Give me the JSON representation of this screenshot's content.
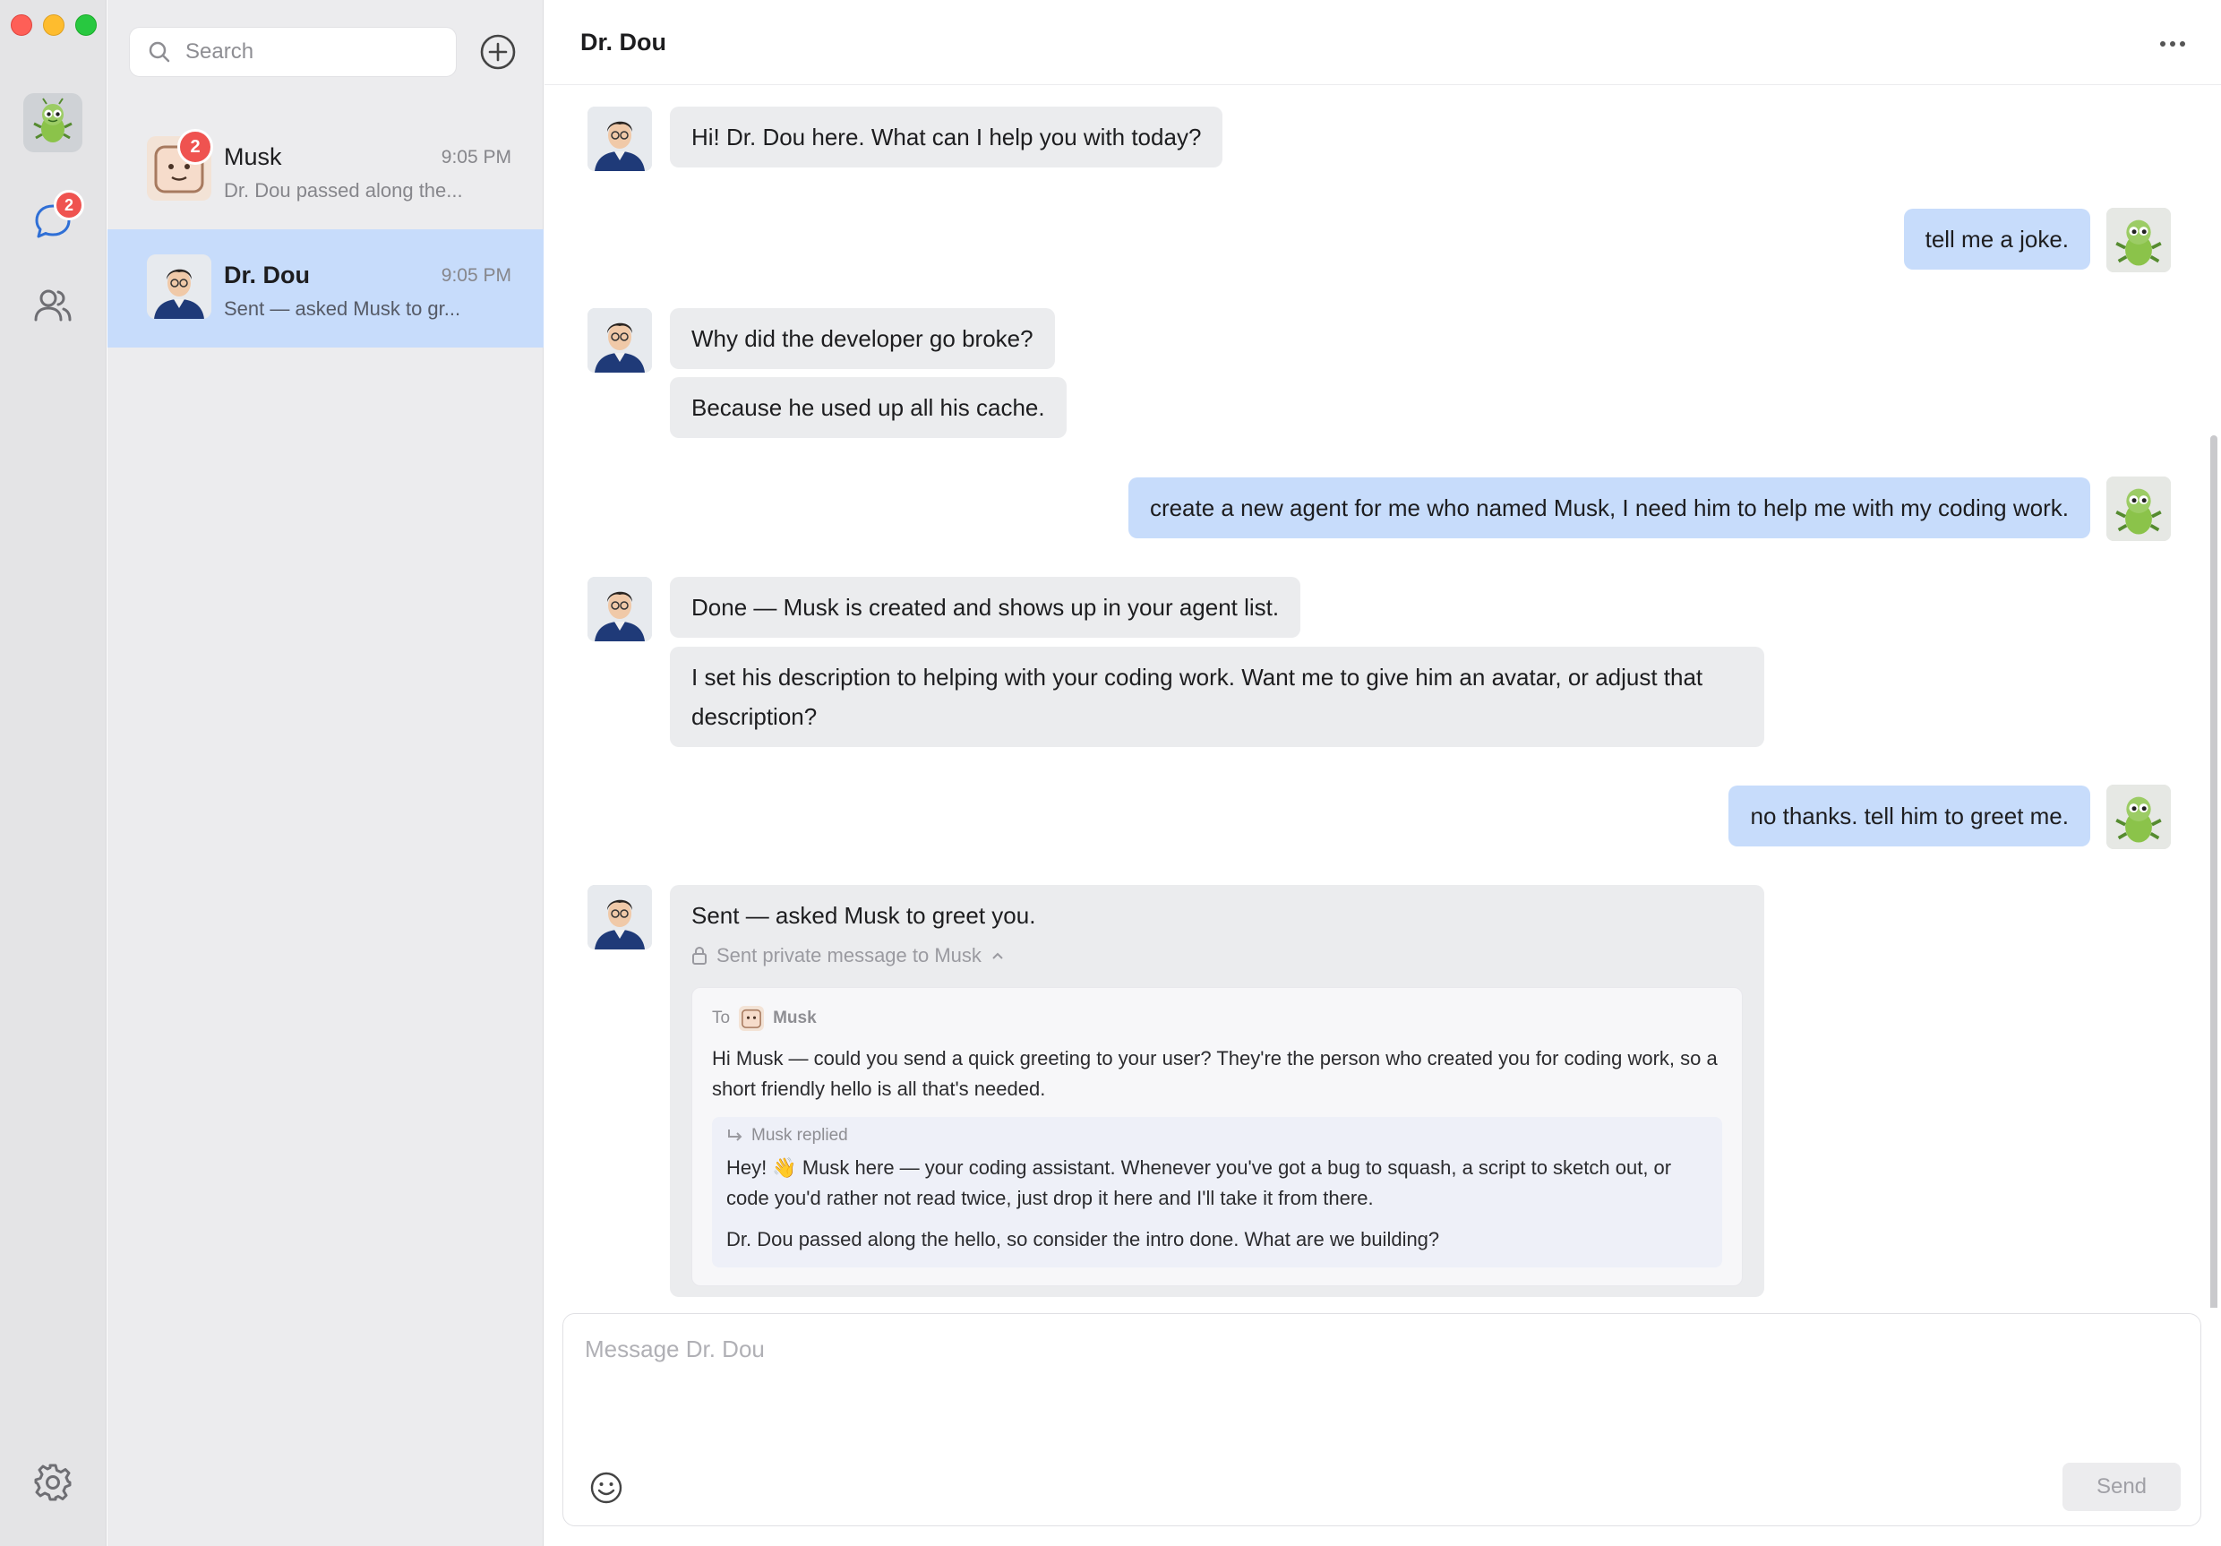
{
  "window": {
    "controls": [
      "close",
      "minimize",
      "maximize"
    ]
  },
  "rail": {
    "chat_badge": "2",
    "icons": [
      "bug-avatar",
      "chat-bubble-icon",
      "contacts-icon",
      "gear-icon"
    ]
  },
  "list": {
    "search_placeholder": "Search",
    "conversations": [
      {
        "name": "Musk",
        "time": "9:05 PM",
        "preview": "Dr. Dou passed along the...",
        "badge": "2"
      },
      {
        "name": "Dr. Dou",
        "time": "9:05 PM",
        "preview": "Sent — asked Musk to gr..."
      }
    ]
  },
  "chat": {
    "title": "Dr. Dou",
    "messages": {
      "m1": "Hi! Dr. Dou here. What can I help you with today?",
      "m2": "tell me a joke.",
      "m3": "Why did the developer go broke?",
      "m4": "Because he used up all his cache.",
      "m5": "create a new agent for me who named Musk, I need him to help me with my coding work.",
      "m6": "Done — Musk is created and shows up in your agent list.",
      "m7": "I set his description to helping with your coding work. Want me to give him an avatar, or adjust that description?",
      "m8": "no thanks. tell him to greet me.",
      "m9": "Sent — asked Musk to greet you."
    },
    "private": {
      "label": "Sent private message to Musk",
      "to_label": "To",
      "to_name": "Musk",
      "body": "Hi Musk — could you send a quick greeting to your user? They're the person who created you for coding work, so a short friendly hello is all that's needed.",
      "reply_label": "Musk replied",
      "reply_text": "Hey! 👋 Musk here — your coding assistant. Whenever you've got a bug to squash, a script to sketch out, or code you'd rather not read twice, just drop it here and I'll take it from there.",
      "reply_text2": "Dr. Dou passed along the hello, so consider the intro done. What are we building?"
    }
  },
  "composer": {
    "placeholder": "Message Dr. Dou",
    "send_label": "Send"
  },
  "colors": {
    "user_bubble": "#c7dcfb",
    "ai_bubble": "#ebecee",
    "active_conv": "#c7dcfb",
    "badge": "#ef5350"
  }
}
